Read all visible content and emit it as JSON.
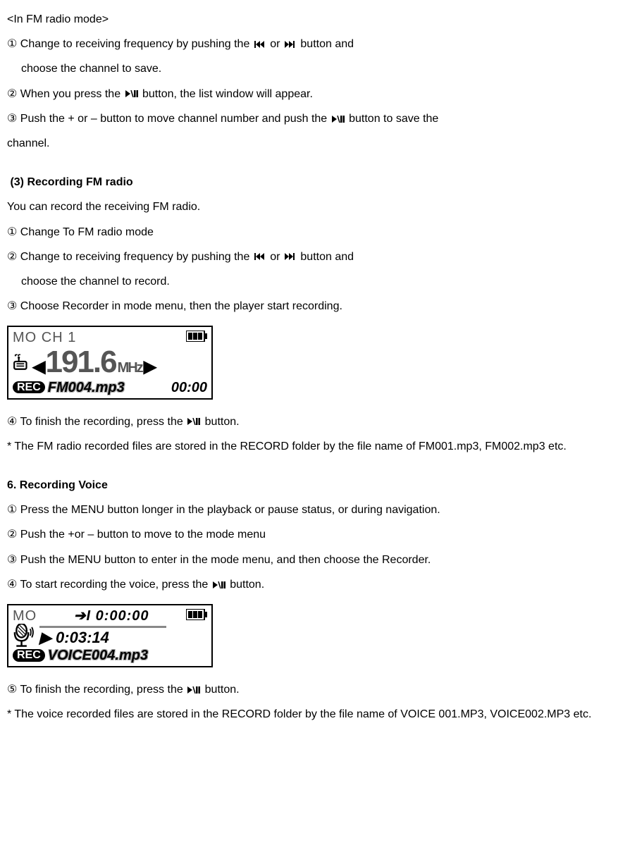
{
  "fm_mode": {
    "heading": "<In FM radio mode>",
    "step1a": "① Change to receiving frequency by pushing the",
    "or": "or",
    "step1b": "button and",
    "step1c": "choose the channel to save.",
    "step2a": "②  When you press the",
    "step2b": "button, the list window will appear.",
    "step3a": "③  Push the + or – button to move channel number and push the",
    "step3b": "button to save the",
    "step3c": "channel."
  },
  "rec_fm": {
    "heading": "(3) Recording FM radio",
    "intro": "You can record the receiving FM radio.",
    "step1": "①  Change To FM radio mode",
    "step2a": "②  Change to receiving frequency by pushing the",
    "or": "or",
    "step2b": "button and",
    "step2c": "choose the channel to record.",
    "step3": "③  Choose Recorder in mode menu, then the player start recording.",
    "step4a": "④  To finish the recording, press the",
    "step4b": "button.",
    "note": "* The FM radio recorded files are stored in the RECORD folder by the file name of FM001.mp3, FM002.mp3   etc."
  },
  "lcd_fm": {
    "top_left": "MO  CH 1",
    "freq": "191.6",
    "unit": "MHz",
    "rec": "REC",
    "file": "FM004.mp3",
    "time": "00:00"
  },
  "rec_voice": {
    "heading": "6. Recording Voice",
    "step1": "① Press the MENU button longer in the playback or pause status, or during navigation.",
    "step2": "② Push the +or – button to move to the mode menu",
    "step3": "③  Push the MENU button to enter in the mode menu, and then choose the Recorder.",
    "step4a": "④  To start recording the voice, press the",
    "step4b": "button.",
    "step5a": "⑤  To finish the recording, press the",
    "step5b": "button.",
    "note": "* The voice recorded files are stored in the RECORD folder by the file name of VOICE 001.MP3, VOICE002.MP3 etc."
  },
  "lcd_voice": {
    "top_left": "MO",
    "top_time": "I 0:00:00",
    "elapsed": "0:03:14",
    "rec": "REC",
    "file": "VOICE004.mp3"
  }
}
